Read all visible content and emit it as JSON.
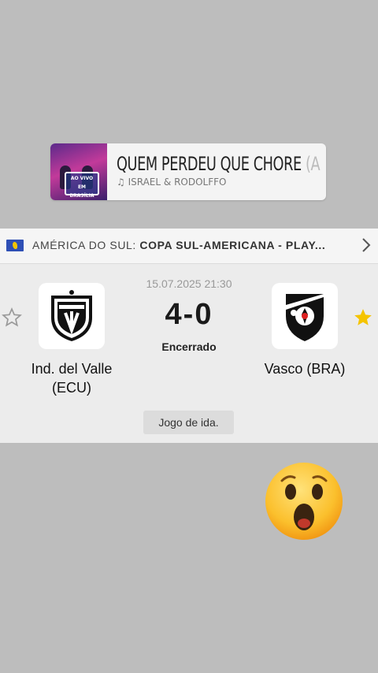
{
  "music": {
    "title": "QUEM PERDEU QUE CHORE",
    "title_overflow": " (A",
    "artist": "ISRAEL & RODOLFFO",
    "note_icon": "music-note-icon",
    "cover_text": "AO VIVO EM BRASÍLIA"
  },
  "match": {
    "region": "AMÉRICA DO SUL:",
    "competition": "COPA SUL-AMERICANA - PLAY...",
    "datetime": "15.07.2025 21:30",
    "score": "4-0",
    "status": "Encerrado",
    "leg": "Jogo de ida.",
    "home": {
      "name": "Ind. del Valle (ECU)",
      "favorite": false
    },
    "away": {
      "name": "Vasco (BRA)",
      "favorite": true
    }
  },
  "colors": {
    "star_active": "#f5c400",
    "star_inactive": "#9a9a9a",
    "flag_blue": "#2e4fb5"
  },
  "sticker": {
    "icon": "surprised-face-emoji"
  }
}
